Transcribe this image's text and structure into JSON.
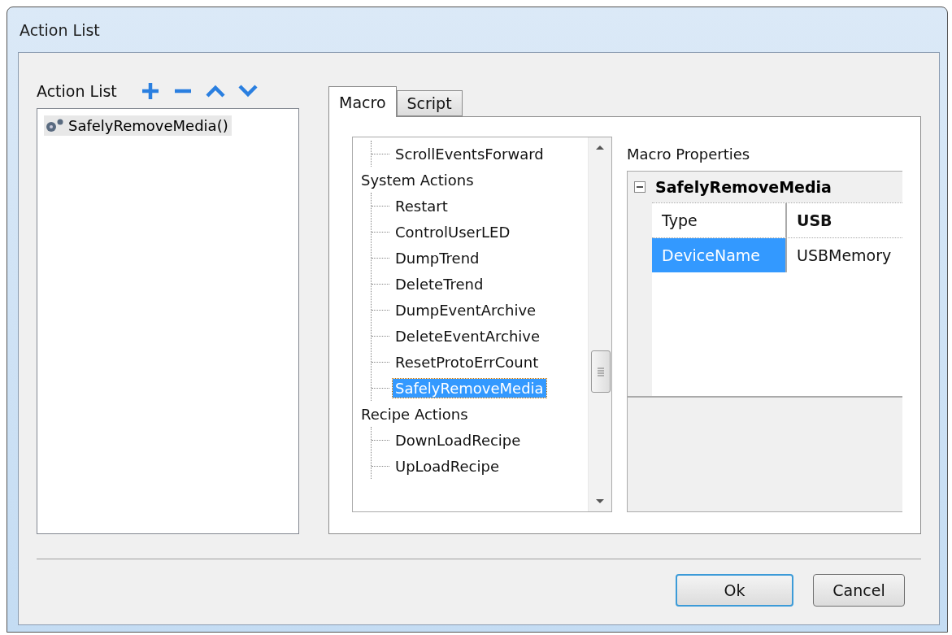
{
  "window": {
    "title": "Action List"
  },
  "action_list": {
    "label": "Action List",
    "items": [
      {
        "label": "SafelyRemoveMedia()",
        "selected": true
      }
    ]
  },
  "tabs": [
    {
      "label": "Macro",
      "selected": true
    },
    {
      "label": "Script",
      "selected": false
    }
  ],
  "tree": [
    {
      "children": [
        {
          "label": "ScrollEventsForward",
          "selected": false
        }
      ]
    },
    {
      "label": "System Actions",
      "children": [
        {
          "label": "Restart",
          "selected": false
        },
        {
          "label": "ControlUserLED",
          "selected": false
        },
        {
          "label": "DumpTrend",
          "selected": false
        },
        {
          "label": "DeleteTrend",
          "selected": false
        },
        {
          "label": "DumpEventArchive",
          "selected": false
        },
        {
          "label": "DeleteEventArchive",
          "selected": false
        },
        {
          "label": "ResetProtoErrCount",
          "selected": false
        },
        {
          "label": "SafelyRemoveMedia",
          "selected": true
        }
      ]
    },
    {
      "label": "Recipe Actions",
      "children": [
        {
          "label": "DownLoadRecipe",
          "selected": false
        },
        {
          "label": "UpLoadRecipe",
          "selected": false
        }
      ]
    }
  ],
  "properties": {
    "label": "Macro Properties",
    "category": "SafelyRemoveMedia",
    "expanded": true,
    "rows": [
      {
        "name": "Type",
        "value": "USB",
        "modified": true,
        "selected": false
      },
      {
        "name": "DeviceName",
        "value": "USBMemory",
        "modified": false,
        "selected": true
      }
    ]
  },
  "buttons": [
    {
      "label": "Ok",
      "default": true
    },
    {
      "label": "Cancel",
      "default": false
    }
  ]
}
